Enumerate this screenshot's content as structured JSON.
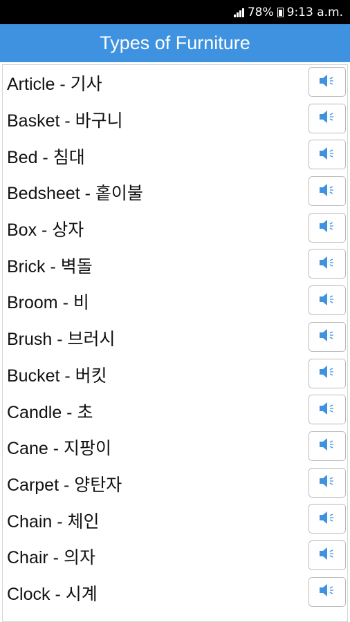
{
  "status_bar": {
    "battery": "78%",
    "time": "9:13 a.m."
  },
  "header": {
    "title": "Types of Furniture"
  },
  "items": [
    {
      "text": "Article - 기사"
    },
    {
      "text": "Basket - 바구니"
    },
    {
      "text": "Bed - 침대"
    },
    {
      "text": "Bedsheet - 홑이불"
    },
    {
      "text": "Box - 상자"
    },
    {
      "text": "Brick - 벽돌"
    },
    {
      "text": "Broom - 비"
    },
    {
      "text": "Brush - 브러시"
    },
    {
      "text": "Bucket - 버킷"
    },
    {
      "text": "Candle - 초"
    },
    {
      "text": "Cane - 지팡이"
    },
    {
      "text": "Carpet - 양탄자"
    },
    {
      "text": "Chain - 체인"
    },
    {
      "text": "Chair - 의자"
    },
    {
      "text": "Clock - 시계"
    }
  ],
  "icons": {
    "row_button": "speaker-icon"
  },
  "colors": {
    "header_bg": "#3f92e0",
    "speaker_icon": "#3f92e0",
    "status_bar_bg": "#000000"
  }
}
